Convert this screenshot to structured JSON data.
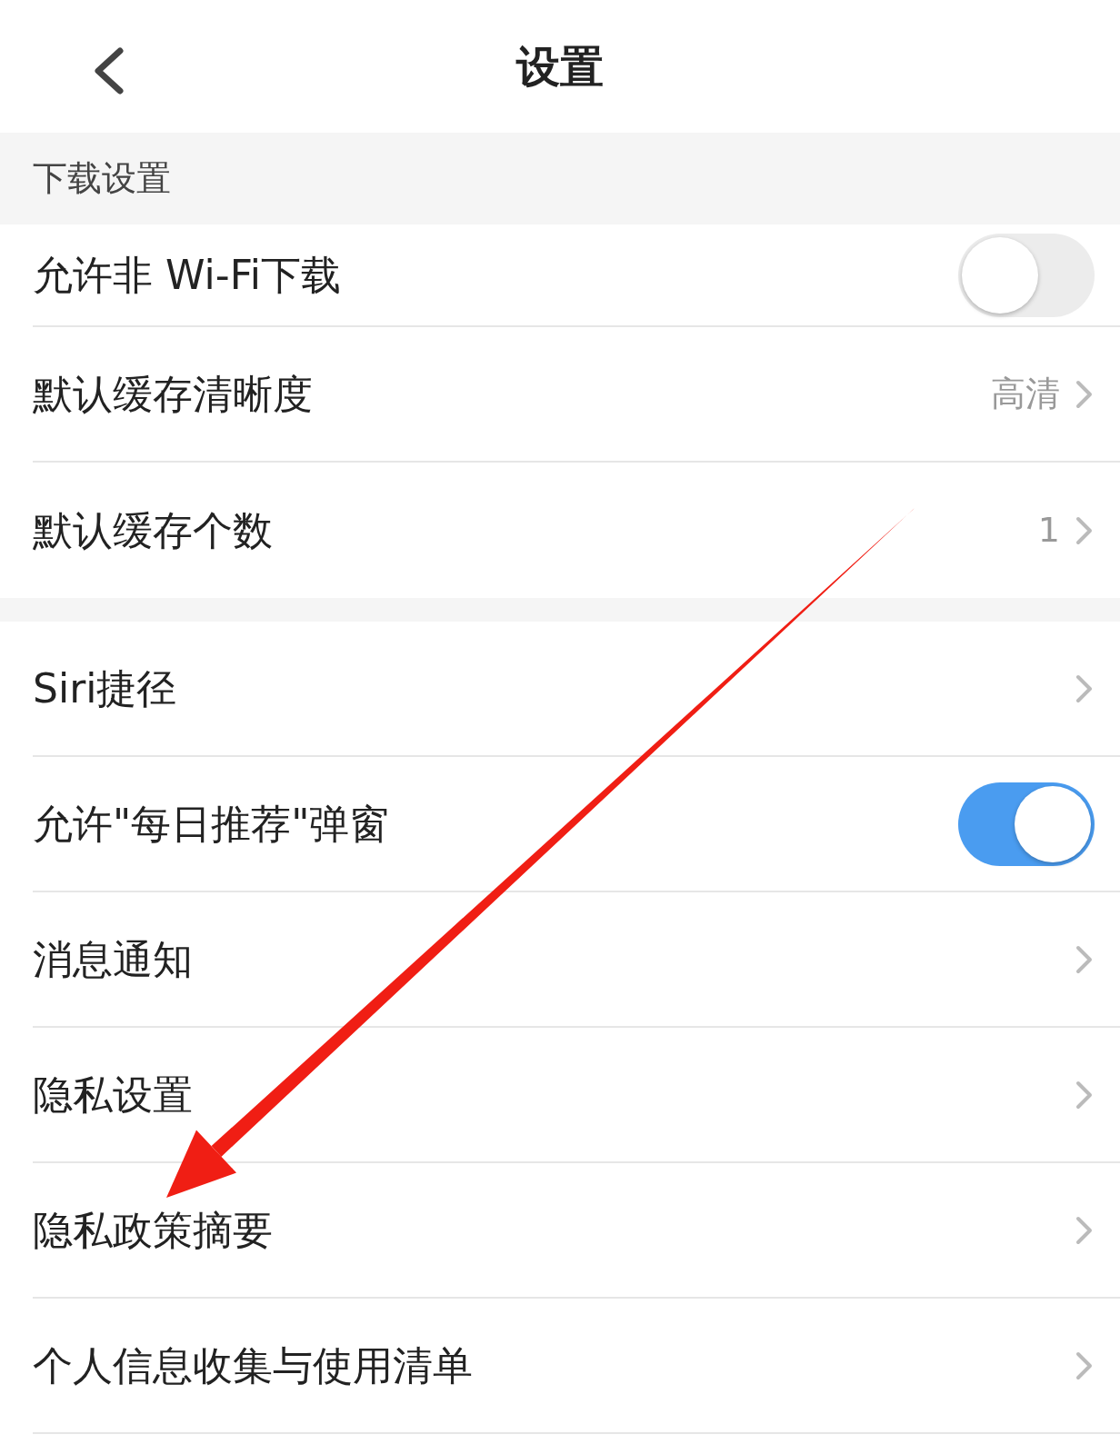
{
  "header": {
    "title": "设置"
  },
  "sections": [
    {
      "title": "下载设置",
      "rows": [
        {
          "kind": "toggle",
          "label": "允许非 Wi-Fi下载",
          "on": false
        },
        {
          "kind": "link",
          "label": "默认缓存清晰度",
          "value": "高清"
        },
        {
          "kind": "link",
          "label": "默认缓存个数",
          "value": "1"
        }
      ]
    },
    {
      "rows": [
        {
          "kind": "link",
          "label": "Siri捷径"
        },
        {
          "kind": "toggle",
          "label": "允许\"每日推荐\"弹窗",
          "on": true
        },
        {
          "kind": "link",
          "label": "消息通知"
        },
        {
          "kind": "link",
          "label": "隐私设置"
        },
        {
          "kind": "link",
          "label": "隐私政策摘要"
        },
        {
          "kind": "link",
          "label": "个人信息收集与使用清单"
        }
      ]
    }
  ]
}
